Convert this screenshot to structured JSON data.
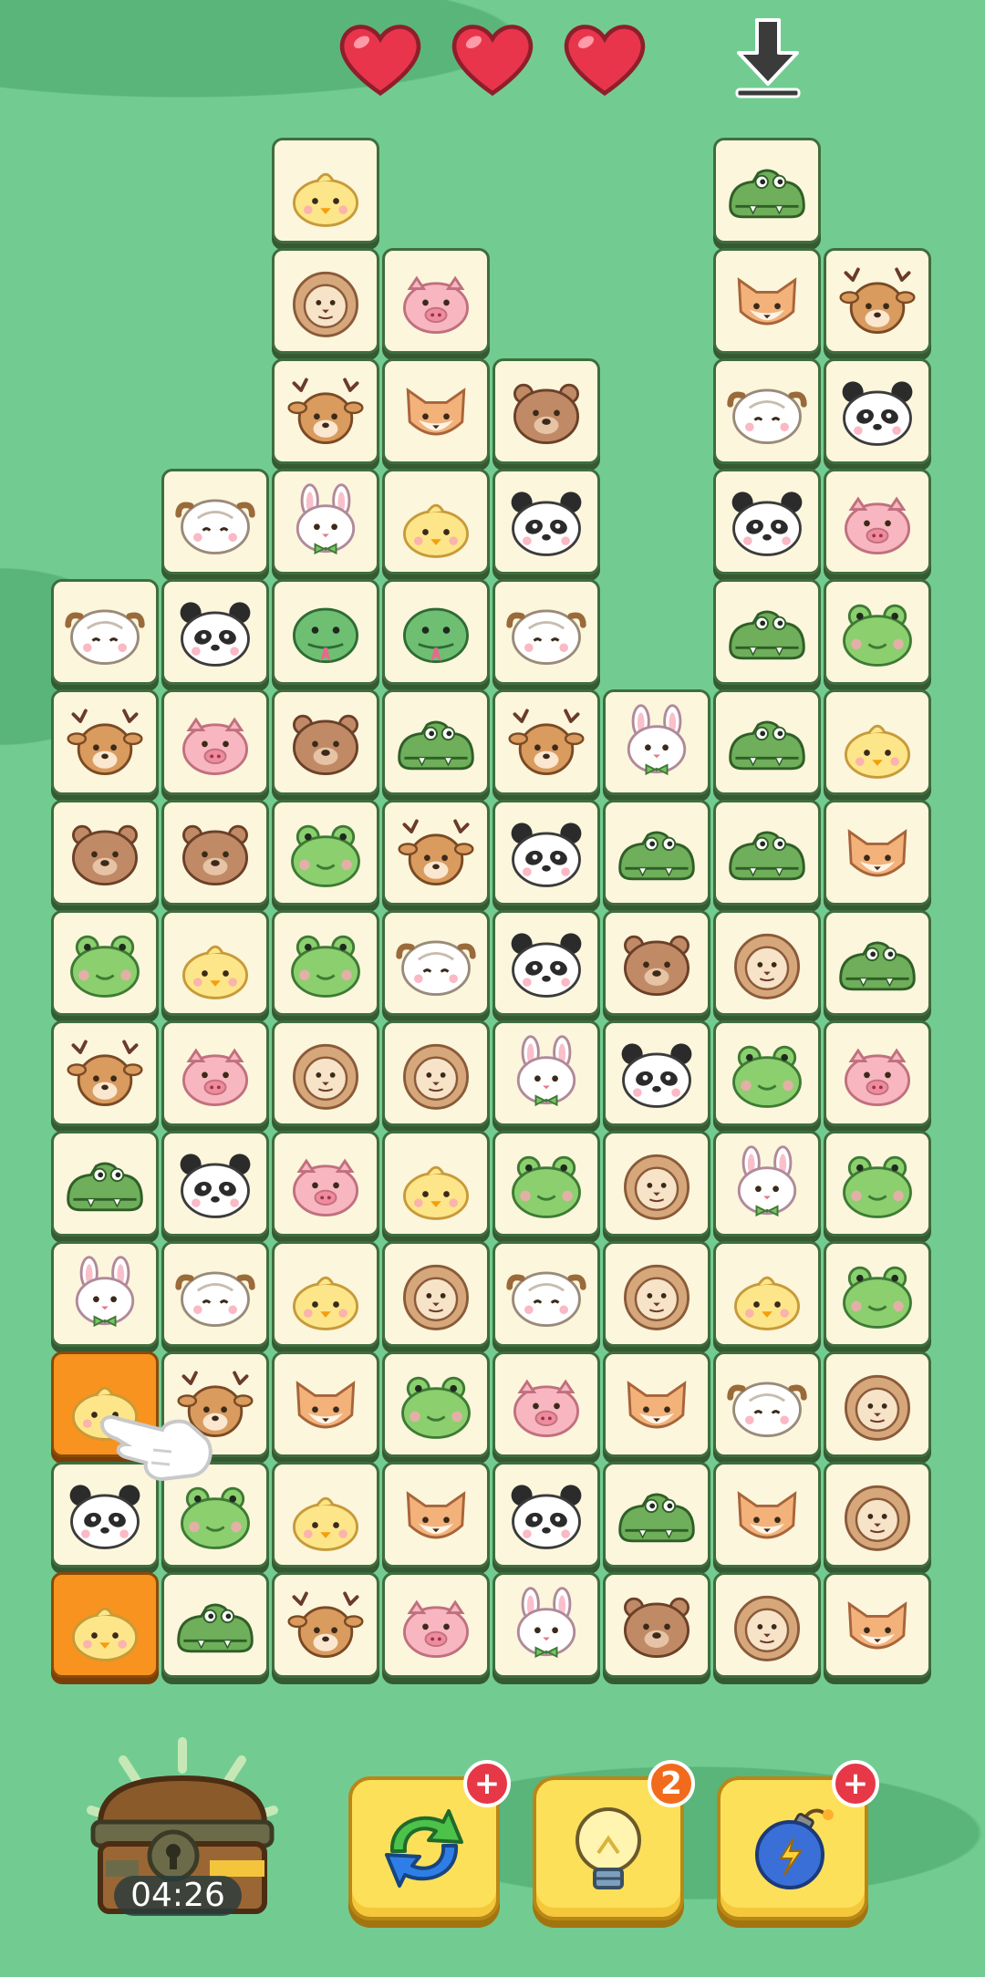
{
  "hud": {
    "lives": 3,
    "heart_icons": [
      "heart-icon",
      "heart-icon",
      "heart-icon"
    ],
    "download_icon": "download-icon"
  },
  "board": {
    "selected_icon_color": "#f7931e",
    "tiles": [
      {
        "row": 0,
        "col": 2,
        "animal": "chick"
      },
      {
        "row": 0,
        "col": 6,
        "animal": "crocodile"
      },
      {
        "row": 1,
        "col": 2,
        "animal": "lion"
      },
      {
        "row": 1,
        "col": 3,
        "animal": "pig"
      },
      {
        "row": 1,
        "col": 6,
        "animal": "fox"
      },
      {
        "row": 1,
        "col": 7,
        "animal": "deer"
      },
      {
        "row": 2,
        "col": 2,
        "animal": "deer"
      },
      {
        "row": 2,
        "col": 3,
        "animal": "fox"
      },
      {
        "row": 2,
        "col": 4,
        "animal": "bear"
      },
      {
        "row": 2,
        "col": 6,
        "animal": "sheep"
      },
      {
        "row": 2,
        "col": 7,
        "animal": "panda"
      },
      {
        "row": 3,
        "col": 1,
        "animal": "sheep"
      },
      {
        "row": 3,
        "col": 2,
        "animal": "rabbit"
      },
      {
        "row": 3,
        "col": 3,
        "animal": "chick"
      },
      {
        "row": 3,
        "col": 4,
        "animal": "panda"
      },
      {
        "row": 3,
        "col": 6,
        "animal": "panda"
      },
      {
        "row": 3,
        "col": 7,
        "animal": "pig"
      },
      {
        "row": 4,
        "col": 0,
        "animal": "sheep"
      },
      {
        "row": 4,
        "col": 1,
        "animal": "panda"
      },
      {
        "row": 4,
        "col": 2,
        "animal": "snake"
      },
      {
        "row": 4,
        "col": 3,
        "animal": "snake"
      },
      {
        "row": 4,
        "col": 4,
        "animal": "sheep"
      },
      {
        "row": 4,
        "col": 6,
        "animal": "crocodile"
      },
      {
        "row": 4,
        "col": 7,
        "animal": "frog"
      },
      {
        "row": 5,
        "col": 0,
        "animal": "deer"
      },
      {
        "row": 5,
        "col": 1,
        "animal": "pig"
      },
      {
        "row": 5,
        "col": 2,
        "animal": "bear"
      },
      {
        "row": 5,
        "col": 3,
        "animal": "crocodile"
      },
      {
        "row": 5,
        "col": 4,
        "animal": "deer"
      },
      {
        "row": 5,
        "col": 5,
        "animal": "rabbit"
      },
      {
        "row": 5,
        "col": 6,
        "animal": "crocodile"
      },
      {
        "row": 5,
        "col": 7,
        "animal": "chick"
      },
      {
        "row": 6,
        "col": 0,
        "animal": "bear"
      },
      {
        "row": 6,
        "col": 1,
        "animal": "bear"
      },
      {
        "row": 6,
        "col": 2,
        "animal": "frog"
      },
      {
        "row": 6,
        "col": 3,
        "animal": "deer"
      },
      {
        "row": 6,
        "col": 4,
        "animal": "panda"
      },
      {
        "row": 6,
        "col": 5,
        "animal": "crocodile"
      },
      {
        "row": 6,
        "col": 6,
        "animal": "crocodile"
      },
      {
        "row": 6,
        "col": 7,
        "animal": "fox"
      },
      {
        "row": 7,
        "col": 0,
        "animal": "frog"
      },
      {
        "row": 7,
        "col": 1,
        "animal": "chick"
      },
      {
        "row": 7,
        "col": 2,
        "animal": "frog"
      },
      {
        "row": 7,
        "col": 3,
        "animal": "sheep"
      },
      {
        "row": 7,
        "col": 4,
        "animal": "panda"
      },
      {
        "row": 7,
        "col": 5,
        "animal": "bear"
      },
      {
        "row": 7,
        "col": 6,
        "animal": "lion"
      },
      {
        "row": 7,
        "col": 7,
        "animal": "crocodile"
      },
      {
        "row": 8,
        "col": 0,
        "animal": "deer"
      },
      {
        "row": 8,
        "col": 1,
        "animal": "pig"
      },
      {
        "row": 8,
        "col": 2,
        "animal": "lion"
      },
      {
        "row": 8,
        "col": 3,
        "animal": "lion"
      },
      {
        "row": 8,
        "col": 4,
        "animal": "rabbit"
      },
      {
        "row": 8,
        "col": 5,
        "animal": "panda"
      },
      {
        "row": 8,
        "col": 6,
        "animal": "frog"
      },
      {
        "row": 8,
        "col": 7,
        "animal": "pig"
      },
      {
        "row": 9,
        "col": 0,
        "animal": "crocodile"
      },
      {
        "row": 9,
        "col": 1,
        "animal": "panda"
      },
      {
        "row": 9,
        "col": 2,
        "animal": "pig"
      },
      {
        "row": 9,
        "col": 3,
        "animal": "chick"
      },
      {
        "row": 9,
        "col": 4,
        "animal": "frog"
      },
      {
        "row": 9,
        "col": 5,
        "animal": "lion"
      },
      {
        "row": 9,
        "col": 6,
        "animal": "rabbit"
      },
      {
        "row": 9,
        "col": 7,
        "animal": "frog"
      },
      {
        "row": 10,
        "col": 0,
        "animal": "rabbit"
      },
      {
        "row": 10,
        "col": 1,
        "animal": "sheep"
      },
      {
        "row": 10,
        "col": 2,
        "animal": "chick"
      },
      {
        "row": 10,
        "col": 3,
        "animal": "lion"
      },
      {
        "row": 10,
        "col": 4,
        "animal": "sheep"
      },
      {
        "row": 10,
        "col": 5,
        "animal": "lion"
      },
      {
        "row": 10,
        "col": 6,
        "animal": "chick"
      },
      {
        "row": 10,
        "col": 7,
        "animal": "frog"
      },
      {
        "row": 11,
        "col": 0,
        "animal": "chick",
        "selected": true
      },
      {
        "row": 11,
        "col": 1,
        "animal": "deer"
      },
      {
        "row": 11,
        "col": 2,
        "animal": "fox"
      },
      {
        "row": 11,
        "col": 3,
        "animal": "frog"
      },
      {
        "row": 11,
        "col": 4,
        "animal": "pig"
      },
      {
        "row": 11,
        "col": 5,
        "animal": "fox"
      },
      {
        "row": 11,
        "col": 6,
        "animal": "sheep"
      },
      {
        "row": 11,
        "col": 7,
        "animal": "lion"
      },
      {
        "row": 12,
        "col": 0,
        "animal": "panda"
      },
      {
        "row": 12,
        "col": 1,
        "animal": "frog"
      },
      {
        "row": 12,
        "col": 2,
        "animal": "chick"
      },
      {
        "row": 12,
        "col": 3,
        "animal": "fox"
      },
      {
        "row": 12,
        "col": 4,
        "animal": "panda"
      },
      {
        "row": 12,
        "col": 5,
        "animal": "crocodile"
      },
      {
        "row": 12,
        "col": 6,
        "animal": "fox"
      },
      {
        "row": 12,
        "col": 7,
        "animal": "lion"
      },
      {
        "row": 13,
        "col": 0,
        "animal": "chick",
        "selected": true
      },
      {
        "row": 13,
        "col": 1,
        "animal": "crocodile"
      },
      {
        "row": 13,
        "col": 2,
        "animal": "deer"
      },
      {
        "row": 13,
        "col": 3,
        "animal": "pig"
      },
      {
        "row": 13,
        "col": 4,
        "animal": "rabbit"
      },
      {
        "row": 13,
        "col": 5,
        "animal": "bear"
      },
      {
        "row": 13,
        "col": 6,
        "animal": "lion"
      },
      {
        "row": 13,
        "col": 7,
        "animal": "fox"
      }
    ]
  },
  "tutorial": {
    "hand_icon": "pointing-hand-icon"
  },
  "bottom": {
    "timer": "04:26",
    "chest_icon": "treasure-chest-icon",
    "boosters": [
      {
        "name": "shuffle",
        "icon": "shuffle-arrows-icon",
        "badge_type": "plus",
        "badge": "+"
      },
      {
        "name": "hint",
        "icon": "lightbulb-icon",
        "badge_type": "count",
        "badge": "2"
      },
      {
        "name": "bomb",
        "icon": "bomb-icon",
        "badge_type": "plus",
        "badge": "+"
      }
    ]
  }
}
